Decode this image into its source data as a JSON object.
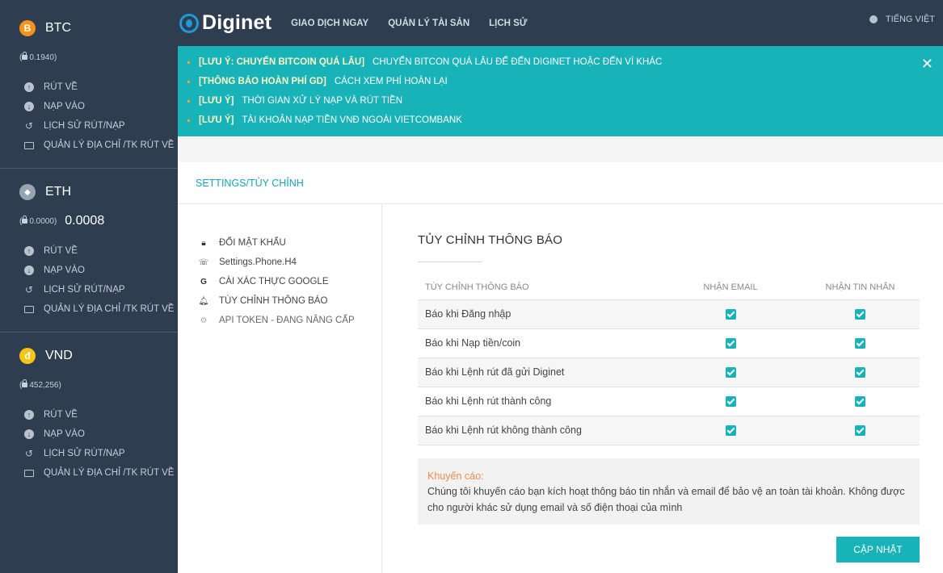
{
  "sidebar": {
    "coins": [
      {
        "name": "BTC",
        "icon_char": "B",
        "icon_color": "#f7931a",
        "locked": "0.1940",
        "balance": "",
        "menu": [
          "RÚT VỀ",
          "NẠP VÀO",
          "LỊCH SỬ RÚT/NẠP",
          "QUẢN LÝ ĐỊA CHỈ /TK RÚT VỀ"
        ]
      },
      {
        "name": "ETH",
        "icon_char": "◆",
        "icon_color": "#9aa4b0",
        "locked": "0.0000",
        "balance": "0.0008",
        "menu": [
          "RÚT VỀ",
          "NẠP VÀO",
          "LỊCH SỬ RÚT/NẠP",
          "QUẢN LÝ ĐỊA CHỈ /TK RÚT VỀ"
        ]
      },
      {
        "name": "VND",
        "icon_char": "đ",
        "icon_color": "#f5c518",
        "locked": "452,256",
        "balance": "",
        "menu": [
          "RÚT VỀ",
          "NẠP VÀO",
          "LỊCH SỬ RÚT/NẠP",
          "QUẢN LÝ ĐỊA CHỈ /TK RÚT VỀ"
        ]
      }
    ]
  },
  "header": {
    "logo": "Diginet",
    "nav": [
      "GIAO DỊCH NGAY",
      "QUẢN LÝ TÀI SẢN",
      "LỊCH SỬ"
    ],
    "language": "TIẾNG VIỆT"
  },
  "banner": {
    "items": [
      {
        "tag": "[LƯU Ý: CHUYỂN BITCOIN QUÁ LÂU]",
        "text": "CHUYỂN BITCON QUÁ LÂU ĐỂ ĐẾN DIGINET HOẶC ĐẾN VÍ KHÁC"
      },
      {
        "tag": "[THÔNG BÁO HOÀN PHÍ GD]",
        "text": "CÁCH XEM PHÍ HOÀN LẠI"
      },
      {
        "tag": "[LƯU Ý]",
        "text": "THỜI GIAN XỬ LÝ NẠP VÀ RÚT TIỀN"
      },
      {
        "tag": "[LƯU Ý]",
        "text": "TÀI KHOẢN NẠP TIỀN VNĐ NGOÀI VIETCOMBANK"
      }
    ],
    "close_icon": "close-icon"
  },
  "settings": {
    "title": "SETTINGS/TÙY CHỈNH",
    "menu": [
      {
        "label": "ĐỔI MẬT KHẨU",
        "icon": "lock-icon"
      },
      {
        "label": "Settings.Phone.H4",
        "icon": "phone-icon"
      },
      {
        "label": "CÀI XÁC THỰC GOOGLE",
        "icon": "google-icon"
      },
      {
        "label": "TÙY CHỈNH THÔNG BÁO",
        "icon": "bell-icon"
      },
      {
        "label": "API TOKEN - ĐANG NÂNG CẤP",
        "icon": "gear-icon"
      }
    ]
  },
  "notify": {
    "heading": "TỦY CHỈNH THÔNG BÁO",
    "columns": [
      "TÙY CHỈNH THÔNG BÁO",
      "NHẬN EMAIL",
      "NHẬN TIN NHẮN"
    ],
    "rows": [
      {
        "label": "Báo khi Đăng nhập",
        "email": true,
        "sms": true
      },
      {
        "label": "Báo khi Nạp tiền/coin",
        "email": true,
        "sms": true
      },
      {
        "label": "Báo khi Lệnh rút đã gửi Diginet",
        "email": true,
        "sms": true
      },
      {
        "label": "Báo khi Lệnh rút thành công",
        "email": true,
        "sms": true
      },
      {
        "label": "Báo khi Lệnh rút không thành công",
        "email": true,
        "sms": true
      }
    ],
    "notice_title": "Khuyến cáo:",
    "notice_body": "Chúng tôi khuyến cáo bạn kích hoạt thông báo tin nhắn và email để bảo vệ an toàn tài khoản. Không được cho người khác sử dụng email và số điện thoại của mình",
    "button": "CẬP NHẬT"
  }
}
